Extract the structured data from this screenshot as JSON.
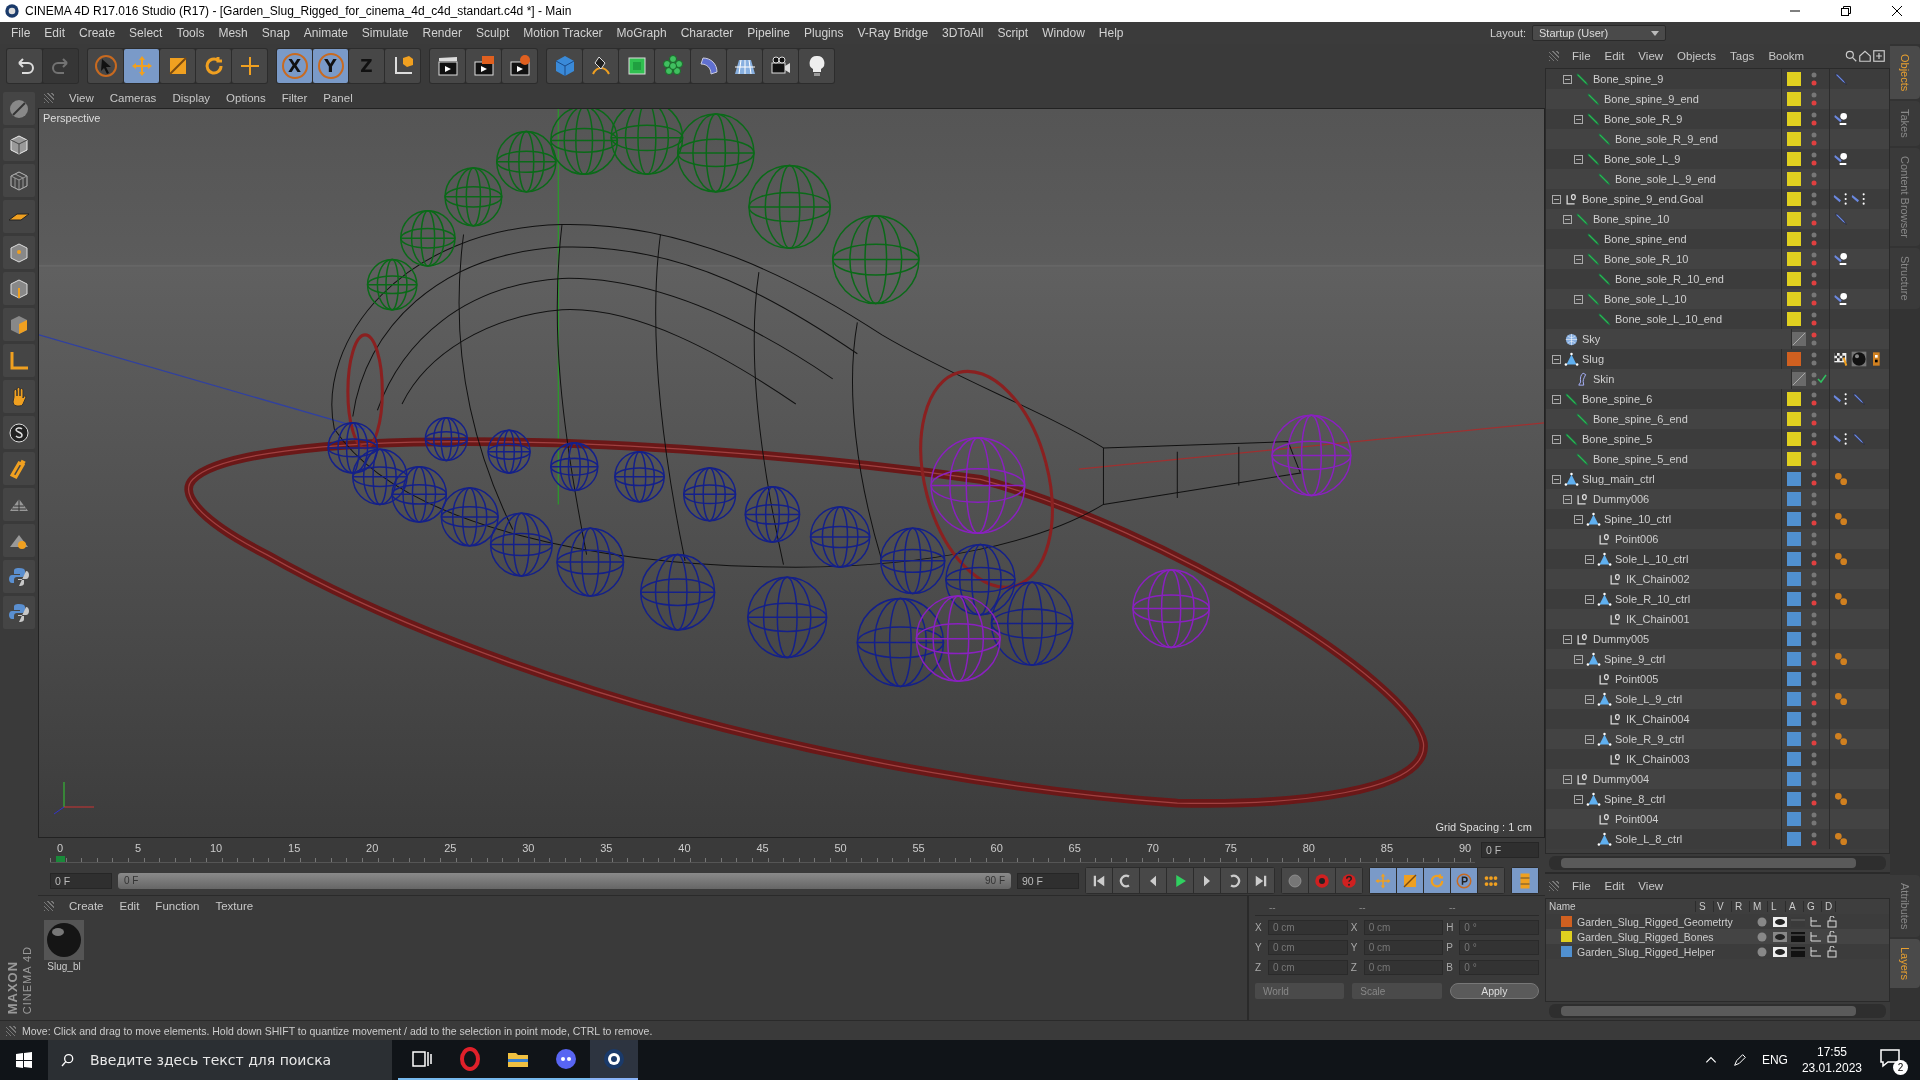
{
  "window": {
    "title": "CINEMA 4D R17.016 Studio (R17) - [Garden_Slug_Rigged_for_cinema_4d_c4d_standart.c4d *] - Main"
  },
  "menu": [
    "File",
    "Edit",
    "Create",
    "Select",
    "Tools",
    "Mesh",
    "Snap",
    "Animate",
    "Simulate",
    "Render",
    "Sculpt",
    "Motion Tracker",
    "MoGraph",
    "Character",
    "Pipeline",
    "Plugins",
    "V-Ray Bridge",
    "3DToAll",
    "Script",
    "Window",
    "Help"
  ],
  "layout": {
    "label": "Layout:",
    "value": "Startup (User)"
  },
  "toolbar": [
    [
      {
        "kind": "undo",
        "selected": false,
        "disabled": false
      },
      {
        "kind": "redo",
        "selected": false,
        "disabled": true
      }
    ],
    [
      {
        "kind": "select",
        "selected": false,
        "disabled": false
      },
      {
        "kind": "move",
        "selected": true,
        "disabled": false
      },
      {
        "kind": "scale",
        "selected": false,
        "disabled": false
      },
      {
        "kind": "rotate",
        "selected": false,
        "disabled": false
      },
      {
        "kind": "add",
        "selected": false,
        "disabled": false
      }
    ],
    [
      {
        "kind": "axis",
        "label": "X",
        "selected": true,
        "disabled": false
      },
      {
        "kind": "axis",
        "label": "Y",
        "selected": true,
        "disabled": false
      },
      {
        "kind": "axis",
        "label": "Z",
        "selected": false,
        "disabled": false
      },
      {
        "kind": "coord",
        "selected": false,
        "disabled": false
      }
    ],
    [
      {
        "kind": "render",
        "selected": false,
        "disabled": false
      },
      {
        "kind": "render_view",
        "selected": false,
        "disabled": false
      },
      {
        "kind": "render_settings",
        "selected": false,
        "disabled": false
      }
    ],
    [
      {
        "kind": "cube",
        "selected": false,
        "disabled": false
      },
      {
        "kind": "pen",
        "selected": false,
        "disabled": false
      },
      {
        "kind": "subdivision",
        "selected": false,
        "disabled": false
      },
      {
        "kind": "cloner",
        "selected": false,
        "disabled": false
      },
      {
        "kind": "deformer",
        "selected": false,
        "disabled": false
      },
      {
        "kind": "floor",
        "selected": false,
        "disabled": false
      },
      {
        "kind": "camera",
        "selected": false,
        "disabled": false
      },
      {
        "kind": "light",
        "selected": false,
        "disabled": false
      }
    ]
  ],
  "left_tools": [
    {
      "kind": "make_editable",
      "selected": false
    },
    {
      "kind": "model",
      "selected": false
    },
    {
      "kind": "texture",
      "selected": false
    },
    {
      "kind": "workplane",
      "selected": false
    },
    {
      "kind": "points",
      "selected": false
    },
    {
      "kind": "edges",
      "selected": false
    },
    {
      "kind": "polygons",
      "selected": false
    },
    {
      "kind": "axis_mode",
      "selected": false
    },
    {
      "kind": "tweak",
      "selected": false
    },
    {
      "kind": "snap",
      "selected": false
    },
    {
      "kind": "magnet",
      "selected": false
    },
    {
      "kind": "grid_snap",
      "selected": false
    },
    {
      "kind": "locked",
      "selected": false
    },
    {
      "kind": "python",
      "selected": false
    },
    {
      "kind": "python",
      "selected": false
    }
  ],
  "logo": {
    "brand": "MAXON",
    "product": "CINEMA 4D"
  },
  "viewport": {
    "menu": [
      "View",
      "Cameras",
      "Display",
      "Options",
      "Filter",
      "Panel"
    ],
    "camera": "Perspective",
    "grid_spacing": "Grid Spacing : 1 cm"
  },
  "timeline": {
    "ticks": [
      "0",
      "5",
      "10",
      "15",
      "20",
      "25",
      "30",
      "35",
      "40",
      "45",
      "50",
      "55",
      "60",
      "65",
      "70",
      "75",
      "80",
      "85",
      "90"
    ],
    "level": 0,
    "current": "0 F"
  },
  "playback": {
    "start": "0 F",
    "range_start": "0 F",
    "range_end": "90 F",
    "level": 1,
    "end": "90 F",
    "buttons": [
      {
        "kind": "first",
        "selected": false
      },
      {
        "kind": "prev_key",
        "selected": false
      },
      {
        "kind": "prev_frame",
        "selected": false
      },
      {
        "kind": "play",
        "selected": false
      },
      {
        "kind": "next_frame",
        "selected": false
      },
      {
        "kind": "next_key",
        "selected": false
      },
      {
        "kind": "last",
        "selected": false
      }
    ],
    "record": [
      {
        "kind": "keyframe",
        "selected": false
      },
      {
        "kind": "record",
        "selected": false
      },
      {
        "kind": "auto_key",
        "selected": false
      }
    ],
    "channels": [
      {
        "kind": "move",
        "selected": true
      },
      {
        "kind": "scale",
        "selected": true
      },
      {
        "kind": "rotate",
        "selected": true
      },
      {
        "kind": "param",
        "selected": true
      },
      {
        "kind": "points",
        "selected": false
      }
    ],
    "timeline_button": {
      "kind": "film",
      "selected": true
    }
  },
  "materials": {
    "menu": [
      "Create",
      "Edit",
      "Function",
      "Texture"
    ],
    "items": [
      {
        "name": "Slug_bl"
      }
    ]
  },
  "coordinates": {
    "headers": [
      "--",
      "--",
      "--"
    ],
    "rows": [
      {
        "axis": "X",
        "position": "0 cm",
        "size_axis": "X",
        "size": "0 cm",
        "rot_axis": "H",
        "rotation": "0 °"
      },
      {
        "axis": "Y",
        "position": "0 cm",
        "size_axis": "Y",
        "size": "0 cm",
        "rot_axis": "P",
        "rotation": "0 °"
      },
      {
        "axis": "Z",
        "position": "0 cm",
        "size_axis": "Z",
        "size": "0 cm",
        "rot_axis": "B",
        "rotation": "0 °"
      }
    ],
    "mode": "World",
    "size_mode": "Scale",
    "apply": "Apply"
  },
  "object_manager": {
    "menu": [
      "File",
      "Edit",
      "View",
      "Objects",
      "Tags",
      "Bookm"
    ],
    "tree": [
      {
        "children": [
          {
            "name": "Bone_spine_9",
            "kind": "bone",
            "color": "#e0d020",
            "editor_hidden": false,
            "render_hidden": true,
            "tags": [
              {
                "kind": "bone"
              }
            ],
            "children": [
              {
                "name": "Bone_spine_9_end",
                "kind": "bone",
                "color": "#e0d020",
                "editor_hidden": false,
                "render_hidden": true
              },
              {
                "name": "Bone_sole_R_9",
                "kind": "bone",
                "color": "#e0d020",
                "editor_hidden": false,
                "render_hidden": true,
                "tags": [
                  {
                    "kind": "pin"
                  }
                ],
                "children": [
                  {
                    "name": "Bone_sole_R_9_end",
                    "kind": "bone",
                    "color": "#e0d020",
                    "editor_hidden": false,
                    "render_hidden": true
                  }
                ]
              },
              {
                "name": "Bone_sole_L_9",
                "kind": "bone",
                "color": "#e0d020",
                "editor_hidden": false,
                "render_hidden": true,
                "tags": [
                  {
                    "kind": "pin"
                  }
                ],
                "children": [
                  {
                    "name": "Bone_sole_L_9_end",
                    "kind": "bone",
                    "color": "#e0d020",
                    "editor_hidden": false,
                    "render_hidden": true
                  }
                ]
              }
            ]
          }
        ]
      },
      {
        "name": "Bone_spine_9_end.Goal",
        "kind": "null",
        "color": "#e0d020",
        "editor_hidden": false,
        "render_hidden": false,
        "tags": [
          {
            "kind": "constraint"
          },
          {
            "kind": "constraint"
          }
        ],
        "children": [
          {
            "name": "Bone_spine_10",
            "kind": "bone",
            "color": "#e0d020",
            "editor_hidden": false,
            "render_hidden": true,
            "tags": [
              {
                "kind": "bone"
              }
            ],
            "children": [
              {
                "name": "Bone_spine_end",
                "kind": "bone",
                "color": "#e0d020",
                "editor_hidden": false,
                "render_hidden": true
              },
              {
                "name": "Bone_sole_R_10",
                "kind": "bone",
                "color": "#e0d020",
                "editor_hidden": false,
                "render_hidden": true,
                "tags": [
                  {
                    "kind": "pin"
                  }
                ],
                "children": [
                  {
                    "name": "Bone_sole_R_10_end",
                    "kind": "bone",
                    "color": "#e0d020",
                    "editor_hidden": false,
                    "render_hidden": true
                  }
                ]
              },
              {
                "name": "Bone_sole_L_10",
                "kind": "bone",
                "color": "#e0d020",
                "editor_hidden": false,
                "render_hidden": true,
                "tags": [
                  {
                    "kind": "pin"
                  }
                ],
                "children": [
                  {
                    "name": "Bone_sole_L_10_end",
                    "kind": "bone",
                    "color": "#e0d020",
                    "editor_hidden": false,
                    "render_hidden": true
                  }
                ]
              }
            ]
          }
        ]
      },
      {
        "name": "Sky",
        "kind": "sky",
        "editor_hidden": true,
        "render_hidden": false
      },
      {
        "name": "Slug",
        "kind": "polygon",
        "color": "#d06020",
        "editor_hidden": false,
        "render_hidden": false,
        "tags": [
          {
            "kind": "texture"
          },
          {
            "kind": "material"
          },
          {
            "kind": "phong"
          }
        ],
        "children": [
          {
            "name": "Skin",
            "kind": "skin",
            "editor_hidden": false,
            "render_hidden": false,
            "enabled": true
          }
        ]
      },
      {
        "name": "Bone_spine_6",
        "kind": "bone",
        "color": "#e0d020",
        "editor_hidden": false,
        "render_hidden": true,
        "tags": [
          {
            "kind": "constraint"
          },
          {
            "kind": "bone"
          }
        ],
        "children": [
          {
            "name": "Bone_spine_6_end",
            "kind": "bone",
            "color": "#e0d020",
            "editor_hidden": false,
            "render_hidden": true
          }
        ]
      },
      {
        "name": "Bone_spine_5",
        "kind": "bone",
        "color": "#e0d020",
        "editor_hidden": false,
        "render_hidden": true,
        "tags": [
          {
            "kind": "constraint"
          },
          {
            "kind": "bone"
          }
        ],
        "children": [
          {
            "name": "Bone_spine_5_end",
            "kind": "bone",
            "color": "#e0d020",
            "editor_hidden": false,
            "render_hidden": true
          }
        ]
      },
      {
        "name": "Slug_main_ctrl",
        "kind": "control",
        "color": "#5090d0",
        "editor_hidden": false,
        "render_hidden": true,
        "tags": [
          {
            "kind": "dots"
          }
        ],
        "children": [
          {
            "name": "Dummy006",
            "kind": "null",
            "color": "#5090d0",
            "editor_hidden": false,
            "render_hidden": false,
            "children": [
              {
                "name": "Spine_10_ctrl",
                "kind": "control",
                "color": "#5090d0",
                "editor_hidden": false,
                "render_hidden": true,
                "tags": [
                  {
                    "kind": "dots"
                  }
                ],
                "children": [
                  {
                    "name": "Point006",
                    "kind": "null",
                    "color": "#5090d0",
                    "editor_hidden": false,
                    "render_hidden": false
                  },
                  {
                    "name": "Sole_L_10_ctrl",
                    "kind": "control",
                    "color": "#5090d0",
                    "editor_hidden": false,
                    "render_hidden": true,
                    "tags": [
                      {
                        "kind": "dots"
                      }
                    ],
                    "children": [
                      {
                        "name": "IK_Chain002",
                        "kind": "null",
                        "color": "#5090d0",
                        "editor_hidden": false,
                        "render_hidden": false
                      }
                    ]
                  },
                  {
                    "name": "Sole_R_10_ctrl",
                    "kind": "control",
                    "color": "#5090d0",
                    "editor_hidden": false,
                    "render_hidden": true,
                    "tags": [
                      {
                        "kind": "dots"
                      }
                    ],
                    "children": [
                      {
                        "name": "IK_Chain001",
                        "kind": "null",
                        "color": "#5090d0",
                        "editor_hidden": false,
                        "render_hidden": false
                      }
                    ]
                  }
                ]
              }
            ]
          },
          {
            "name": "Dummy005",
            "kind": "null",
            "color": "#5090d0",
            "editor_hidden": false,
            "render_hidden": false,
            "children": [
              {
                "name": "Spine_9_ctrl",
                "kind": "control",
                "color": "#5090d0",
                "editor_hidden": false,
                "render_hidden": true,
                "tags": [
                  {
                    "kind": "dots"
                  }
                ],
                "children": [
                  {
                    "name": "Point005",
                    "kind": "null",
                    "color": "#5090d0",
                    "editor_hidden": false,
                    "render_hidden": false
                  },
                  {
                    "name": "Sole_L_9_ctrl",
                    "kind": "control",
                    "color": "#5090d0",
                    "editor_hidden": false,
                    "render_hidden": true,
                    "tags": [
                      {
                        "kind": "dots"
                      }
                    ],
                    "children": [
                      {
                        "name": "IK_Chain004",
                        "kind": "null",
                        "color": "#5090d0",
                        "editor_hidden": false,
                        "render_hidden": false
                      }
                    ]
                  },
                  {
                    "name": "Sole_R_9_ctrl",
                    "kind": "control",
                    "color": "#5090d0",
                    "editor_hidden": false,
                    "render_hidden": true,
                    "tags": [
                      {
                        "kind": "dots"
                      }
                    ],
                    "children": [
                      {
                        "name": "IK_Chain003",
                        "kind": "null",
                        "color": "#5090d0",
                        "editor_hidden": false,
                        "render_hidden": false
                      }
                    ]
                  }
                ]
              }
            ]
          },
          {
            "name": "Dummy004",
            "kind": "null",
            "color": "#5090d0",
            "editor_hidden": false,
            "render_hidden": false,
            "children": [
              {
                "name": "Spine_8_ctrl",
                "kind": "control",
                "color": "#5090d0",
                "editor_hidden": false,
                "render_hidden": true,
                "tags": [
                  {
                    "kind": "dots"
                  }
                ],
                "children": [
                  {
                    "name": "Point004",
                    "kind": "null",
                    "color": "#5090d0",
                    "editor_hidden": false,
                    "render_hidden": false
                  },
                  {
                    "name": "Sole_L_8_ctrl",
                    "kind": "control",
                    "color": "#5090d0",
                    "editor_hidden": false,
                    "render_hidden": true,
                    "tags": [
                      {
                        "kind": "dots"
                      }
                    ]
                  }
                ]
              }
            ]
          }
        ]
      }
    ]
  },
  "layers": {
    "menu": [
      "File",
      "Edit",
      "View"
    ],
    "columns": [
      "Name",
      "S",
      "V",
      "R",
      "M",
      "L",
      "A",
      "G",
      "D"
    ],
    "rows": [
      {
        "name": "Garden_Slug_Rigged_Geometrty",
        "color": "#d06020",
        "visible": true,
        "render": false
      },
      {
        "name": "Garden_Slug_Rigged_Bones",
        "color": "#e0d020",
        "visible": false,
        "render": true
      },
      {
        "name": "Garden_Slug_Rigged_Helper",
        "color": "#5090d0",
        "visible": true,
        "render": true
      }
    ]
  },
  "side_tabs": [
    {
      "label": "Objects",
      "selected": true
    },
    {
      "label": "Takes",
      "selected": false
    },
    {
      "label": "Content Browser",
      "selected": false
    },
    {
      "label": "Structure",
      "selected": false
    }
  ],
  "side_tabs_lower": [
    {
      "label": "Attributes",
      "selected": false
    },
    {
      "label": "Layers",
      "selected": true
    }
  ],
  "status_bar": "Move: Click and drag to move elements. Hold down SHIFT to quantize movement / add to the selection in point mode, CTRL to remove.",
  "taskbar": {
    "search_placeholder": "Введите здесь текст для поиска",
    "apps": [
      {
        "kind": "task_view",
        "selected": false
      },
      {
        "kind": "opera",
        "selected": false
      },
      {
        "kind": "explorer",
        "selected": false
      },
      {
        "kind": "discord",
        "selected": false
      },
      {
        "kind": "cinema4d",
        "selected": true
      }
    ],
    "language": "ENG",
    "time": "17:55",
    "date": "23.01.2023",
    "notifications": "2"
  }
}
